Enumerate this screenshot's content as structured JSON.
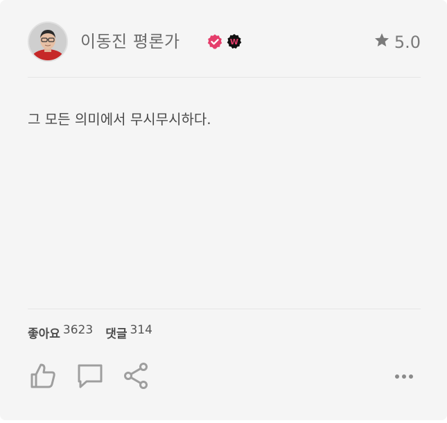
{
  "review": {
    "author_name": "이동진 평론가",
    "rating": "5.0",
    "text": "그 모든 의미에서 무시무시하다.",
    "like_label": "좋아요",
    "like_count": "3623",
    "comment_label": "댓글",
    "comment_count": "314"
  },
  "badges": {
    "verified_icon": "verified-check-icon",
    "w_badge_icon": "w-badge-icon",
    "w_badge_letter": "W"
  },
  "icons": {
    "star": "star-icon",
    "like": "thumbs-up-icon",
    "comment": "comment-bubble-icon",
    "share": "share-icon",
    "more": "more-dots-icon"
  },
  "colors": {
    "card_background": "#f5f5f5",
    "verified_badge": "#e53d6b",
    "w_badge_background": "#111111",
    "w_badge_letter": "#e53d6b",
    "muted_text": "#6b6b6b",
    "icon_gray": "#9e9e9e"
  }
}
